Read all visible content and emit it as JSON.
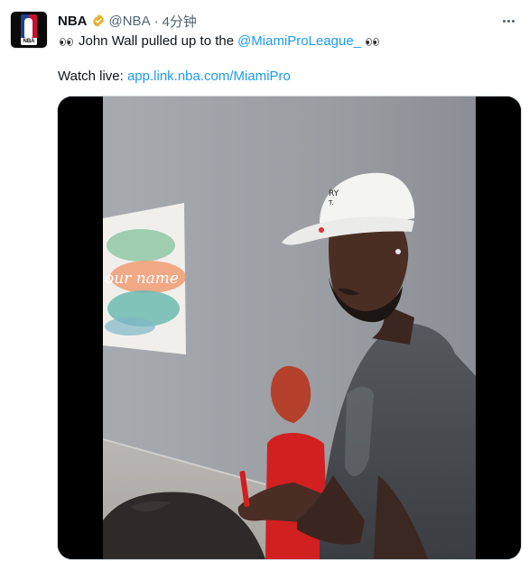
{
  "tweet": {
    "author_name": "NBA",
    "handle": "@NBA",
    "separator": "·",
    "time": "4分钟",
    "text_main": "John Wall pulled up to the",
    "mention": "@MiamiProLeague_",
    "watch_label": "Watch live:",
    "watch_link": "app.link.nba.com/MiamiPro"
  },
  "avatar_logo_text": "NBA",
  "video_poster_text": "our name",
  "icons": [
    "verified-badge-icon",
    "more-options-icon",
    "eyes-emoji-icon"
  ],
  "colors": {
    "link": "#1d9bf0",
    "secondary_text": "#536471",
    "verified": "#e8b02d"
  }
}
